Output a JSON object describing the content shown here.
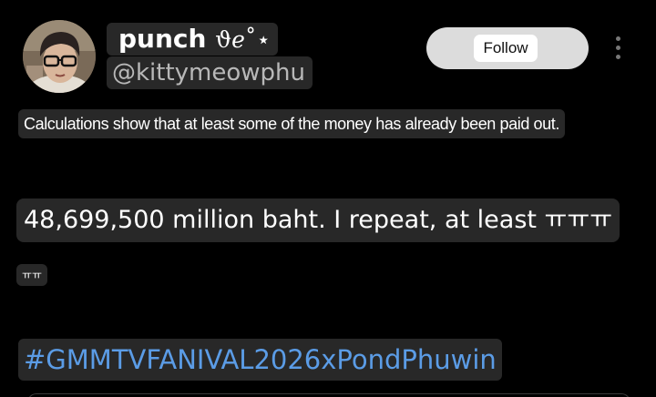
{
  "profile": {
    "display_name": "punch",
    "display_name_symbols": "ϑℯ˚⋆",
    "handle": "@kittymeowphu",
    "avatar_icon": "avatar-photo-icon"
  },
  "actions": {
    "follow_label": "Follow",
    "more_icon": "more-vertical-icon"
  },
  "post": {
    "line1": "Calculations show that at least some of the money has already been paid out.",
    "line2": "48,699,500 million baht. I repeat, at least ㅠㅠㅠ",
    "line3": "ㅠㅠ",
    "hashtag": "#GMMTVFANIVAL2026xPondPhuwin"
  },
  "colors": {
    "background": "#000000",
    "text_highlight": "#404040",
    "hashtag": "#5b9ce6",
    "follow_pill": "#dcdcdc"
  }
}
